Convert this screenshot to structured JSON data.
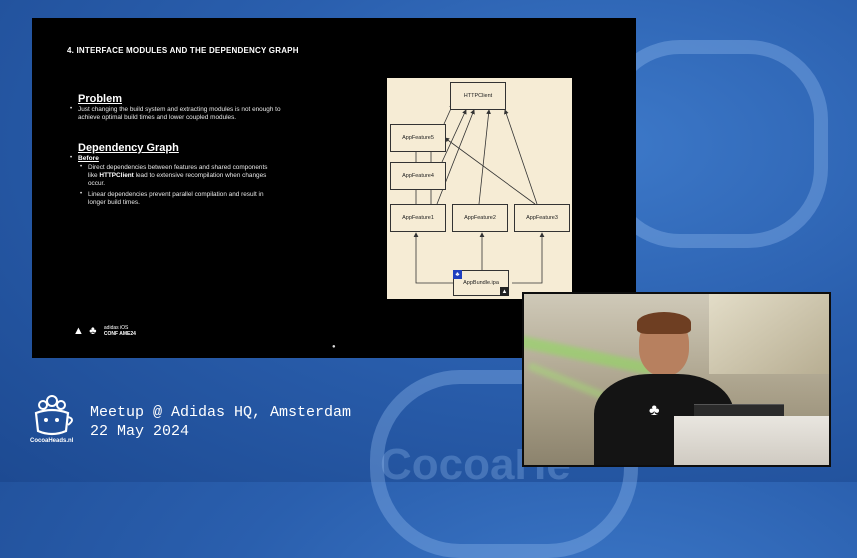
{
  "slide": {
    "title": "4. INTERFACE MODULES AND THE DEPENDENCY GRAPH",
    "problem_heading": "Problem",
    "problem_text": "Just changing the build system and extracting modules is not enough to achieve optimal build times and lower coupled modules.",
    "graph_heading": "Dependency Graph",
    "before_label": "Before",
    "bullet1_pre": "Direct dependencies between features and shared components like ",
    "bullet1_bold": "HTTPClient",
    "bullet1_post": " lead to extensive recompilation when changes occur.",
    "bullet2": "Linear dependencies prevent parallel compilation and result in longer build times.",
    "footer_brand_line1": "adidas iOS",
    "footer_brand_line2": "CONF AME24"
  },
  "diagram": {
    "nodes": {
      "httpclient": "HTTPClient",
      "feature5": "AppFeature5",
      "feature4": "AppFeature4",
      "feature1": "AppFeature1",
      "feature2": "AppFeature2",
      "feature3": "AppFeature3",
      "bundle": "AppBundle.ipa"
    }
  },
  "overlay": {
    "brand": "CocoaHeads.nl",
    "meetup": "Meetup @ Adidas HQ, Amsterdam",
    "date": "22 May 2024"
  }
}
